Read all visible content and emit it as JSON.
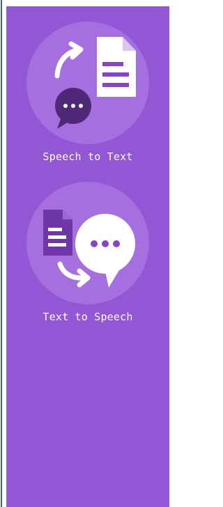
{
  "tools": [
    {
      "label": "Speech to Text",
      "icon": "speech-to-text-icon"
    },
    {
      "label": "Text to Speech",
      "icon": "text-to-speech-icon"
    }
  ],
  "colors": {
    "panel": "#9356d4",
    "icon_circle": "#a66fdf",
    "dark_bubble": "#4f2877",
    "doc_stripe": "#8a43c8",
    "left_rule": "#3e5f86"
  }
}
